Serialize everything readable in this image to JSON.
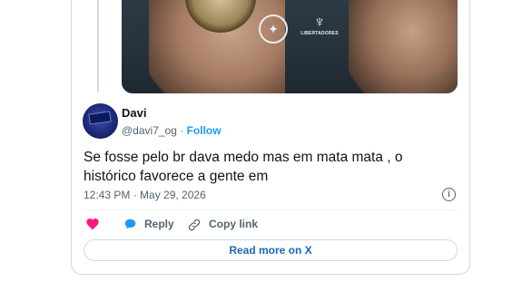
{
  "embed": {
    "media_alt": "",
    "media_logos": {
      "club_icon": "star-icon",
      "libertadores_text": "LIBERTADORES"
    },
    "author": {
      "name": "Davi",
      "handle": "@davi7_og",
      "separator": "·",
      "follow_label": "Follow"
    },
    "text": "Se fosse pelo br dava medo mas em mata mata , o histórico favorece a gente em",
    "timestamp": "12:43 PM · May 29, 2026",
    "actions": {
      "like_icon": "heart-icon",
      "reply_icon": "speech-bubble-icon",
      "reply_label": "Reply",
      "copy_icon": "link-icon",
      "copy_label": "Copy link"
    },
    "read_more_label": "Read more on X"
  },
  "colors": {
    "accent": "#1d9bf0",
    "link": "#1d68b5",
    "like": "#f91880",
    "muted": "#536471",
    "text": "#0f1419",
    "border": "#cfd9de"
  }
}
